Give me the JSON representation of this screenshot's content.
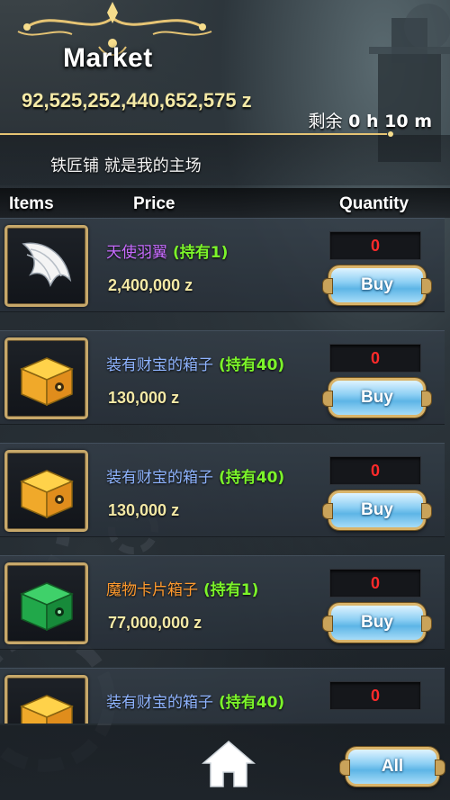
{
  "header": {
    "title": "Market",
    "money": "92,525,252,440,652,575 z",
    "timer_prefix": "剩余",
    "timer_value": "0 h 10 m"
  },
  "subtitle": "铁匠铺 就是我的主场",
  "columns": {
    "items": "Items",
    "price": "Price",
    "quantity": "Quantity"
  },
  "items": [
    {
      "name": "天使羽翼",
      "owned": "(持有1)",
      "price": "2,400,000 z",
      "quantity": "0",
      "buy_label": "Buy",
      "icon": "angel-wing-icon",
      "name_color": "#c86cff"
    },
    {
      "name": "装有财宝的箱子",
      "owned": "(持有40)",
      "price": "130,000 z",
      "quantity": "0",
      "buy_label": "Buy",
      "icon": "treasure-box-icon",
      "name_color": "#8fb4ff"
    },
    {
      "name": "装有财宝的箱子",
      "owned": "(持有40)",
      "price": "130,000 z",
      "quantity": "0",
      "buy_label": "Buy",
      "icon": "treasure-box-icon",
      "name_color": "#8fb4ff"
    },
    {
      "name": "魔物卡片箱子",
      "owned": "(持有1)",
      "price": "77,000,000 z",
      "quantity": "0",
      "buy_label": "Buy",
      "icon": "monster-card-box-icon",
      "name_color": "#ff9a2e"
    },
    {
      "name": "装有财宝的箱子",
      "owned": "(持有40)",
      "price": "",
      "quantity": "0",
      "buy_label": "",
      "icon": "treasure-box-icon",
      "name_color": "#8fb4ff"
    }
  ],
  "footer": {
    "home_icon": "home-icon",
    "all_label": "All"
  }
}
